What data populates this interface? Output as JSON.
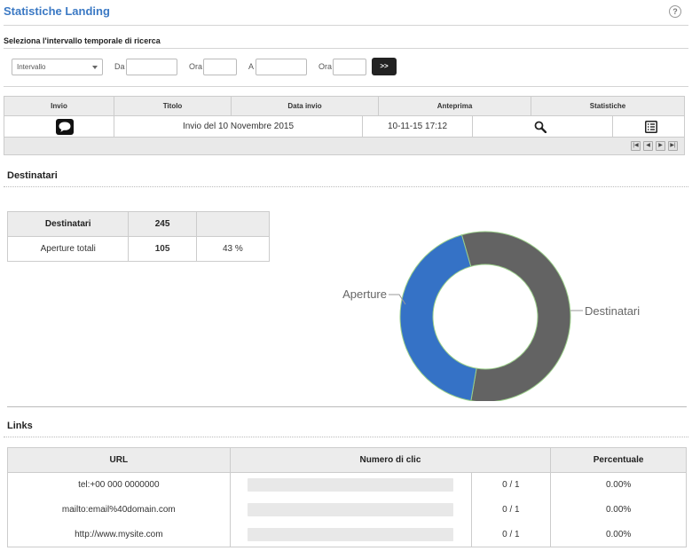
{
  "header": {
    "title": "Statistiche Landing",
    "help_glyph": "?"
  },
  "search": {
    "label": "Seleziona l'intervallo temporale di ricerca",
    "interval_select": "Intervallo",
    "from_label": "Da",
    "from_time_label": "Ora",
    "to_label": "A",
    "to_time_label": "Ora",
    "from_value": "",
    "from_time_value": "",
    "to_value": "",
    "to_time_value": "",
    "go_button": ">>"
  },
  "results": {
    "columns": [
      "Invio",
      "Titolo",
      "Data invio",
      "Anteprima",
      "Statistiche"
    ],
    "rows": [
      {
        "icon": "chat-bubble-icon",
        "title": "Invio del 10 Novembre 2015",
        "date": "10-11-15 17:12",
        "preview_icon": "magnifier-icon",
        "stats_icon": "list-icon"
      }
    ],
    "pager": [
      "|◀",
      "◀",
      "▶",
      "▶|"
    ]
  },
  "destinatari": {
    "section_title": "Destinatari",
    "table": {
      "head": {
        "label": "Destinatari",
        "value": "245",
        "pct": ""
      },
      "row": {
        "label": "Aperture totali",
        "value": "105",
        "pct": "43 %"
      }
    }
  },
  "chart_data": {
    "type": "pie",
    "donut": true,
    "categories": [
      "Aperture",
      "Destinatari"
    ],
    "values": [
      105,
      140
    ],
    "colors": [
      "#3572c6",
      "#636363"
    ],
    "title": "",
    "legend": "none"
  },
  "links": {
    "section_title": "Links",
    "columns": [
      "URL",
      "Numero di clic",
      "",
      "Percentuale"
    ],
    "rows": [
      {
        "url": "tel:+00 000 0000000",
        "progress": 0,
        "clicks": "0 / 1",
        "pct": "0.00%"
      },
      {
        "url": "mailto:email%40domain.com",
        "progress": 0,
        "clicks": "0 / 1",
        "pct": "0.00%"
      },
      {
        "url": "http://www.mysite.com",
        "progress": 0,
        "clicks": "0 / 1",
        "pct": "0.00%"
      }
    ]
  }
}
